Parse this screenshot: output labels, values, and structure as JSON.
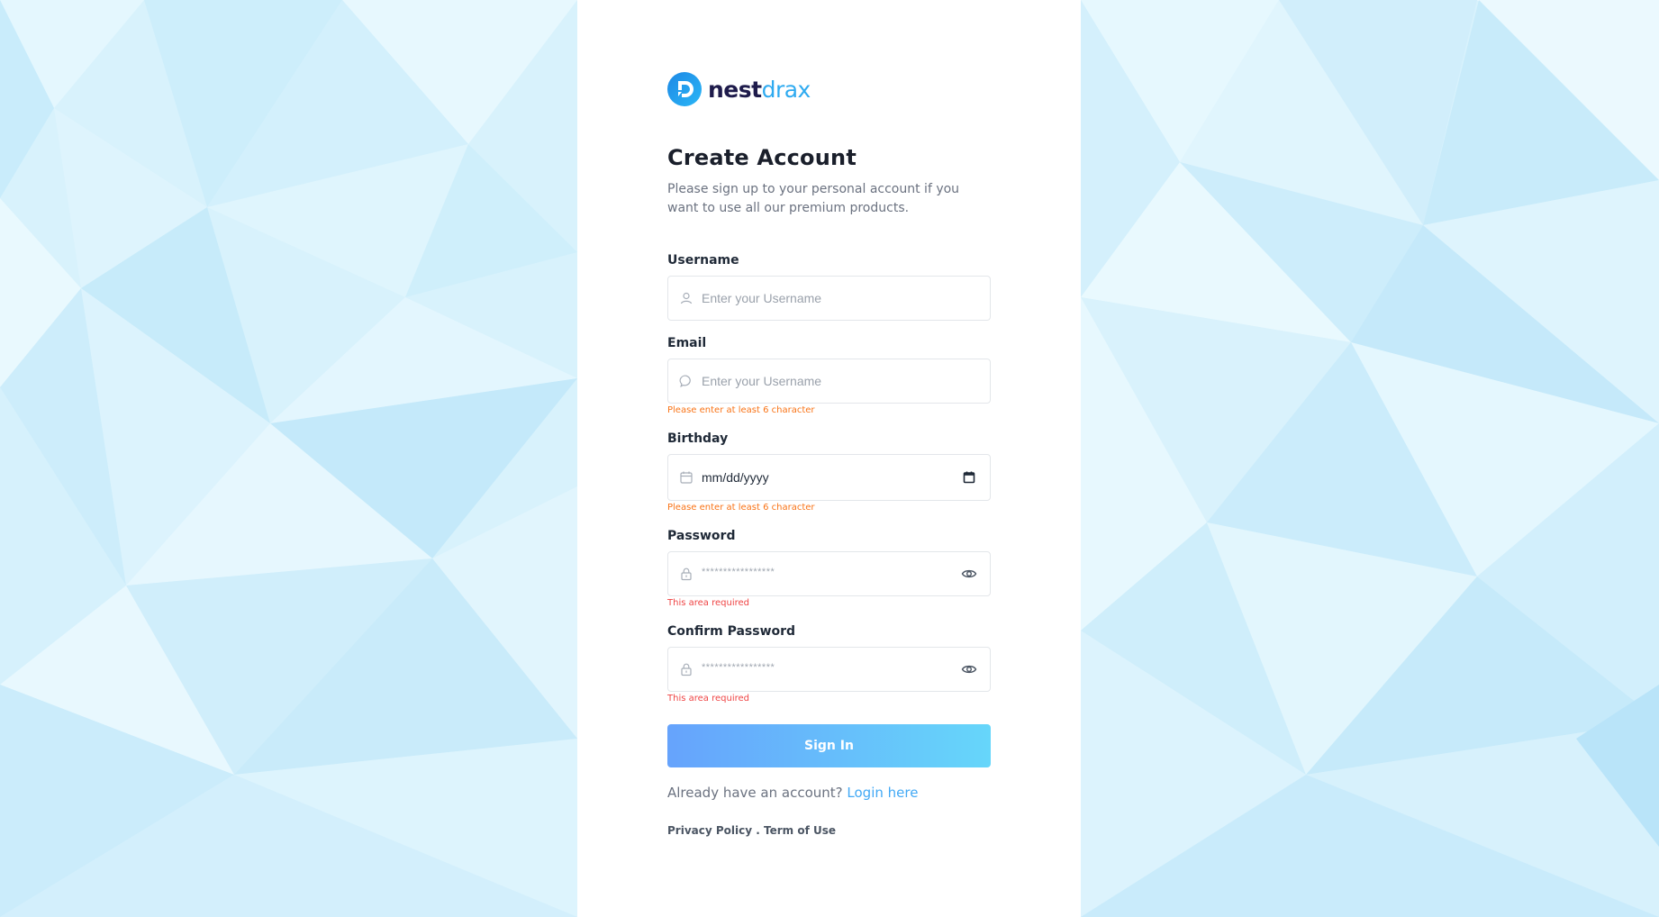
{
  "brand": {
    "name_part1": "nest",
    "name_part2": "drax",
    "primary_color": "#1e1b4b",
    "accent_color": "#2eaaf0",
    "icon": "nestdrax-logo-mark"
  },
  "header": {
    "title": "Create Account",
    "subtitle": "Please sign up to your personal account if you want to use all our premium products."
  },
  "form": {
    "username": {
      "label": "Username",
      "placeholder": "Enter your Username",
      "value": "",
      "icon": "user-icon"
    },
    "email": {
      "label": "Email",
      "placeholder": "Enter your Username",
      "value": "",
      "icon": "chat-bubble-icon",
      "error": "Please enter at least 6 character"
    },
    "birthday": {
      "label": "Birthday",
      "value": "mm/dd/yyyy",
      "icon": "calendar-icon",
      "picker_icon": "calendar-picker-icon",
      "error": "Please enter at least 6 character"
    },
    "password": {
      "label": "Password",
      "value": "*****************",
      "icon": "lock-icon",
      "toggle_icon": "eye-icon",
      "error": "This area required"
    },
    "confirm_password": {
      "label": "Confirm Password",
      "value": "*****************",
      "icon": "lock-icon",
      "toggle_icon": "eye-icon",
      "error": "This area required"
    },
    "submit_label": "Sign In"
  },
  "login_prompt": {
    "text": "Already have an account?",
    "link": "Login here"
  },
  "footer": {
    "privacy": "Privacy Policy",
    "separator": ".",
    "terms": "Term of Use"
  },
  "colors": {
    "error_orange": "#f97316",
    "error_red": "#ef4444",
    "button_start": "#66a3fc",
    "button_end": "#66d6fa",
    "link": "#42a9f5"
  }
}
